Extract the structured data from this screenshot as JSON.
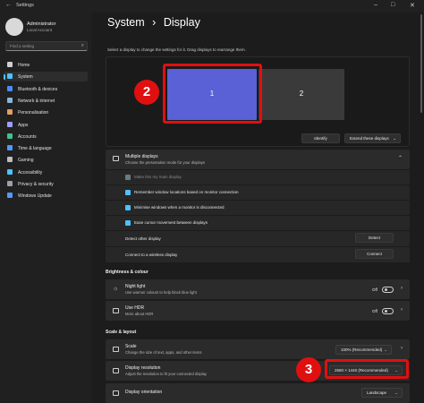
{
  "window": {
    "title": "Settings"
  },
  "user": {
    "name": "Administrator",
    "account": "Local Account"
  },
  "search": {
    "placeholder": "Find a setting"
  },
  "sidebar": {
    "items": [
      {
        "label": "Home",
        "icon": "home-icon",
        "color": "#cfcfcf"
      },
      {
        "label": "System",
        "icon": "system-icon",
        "color": "#4cc2ff"
      },
      {
        "label": "Bluetooth & devices",
        "icon": "bluetooth-icon",
        "color": "#4c8bff"
      },
      {
        "label": "Network & internet",
        "icon": "network-icon",
        "color": "#8ab4d8"
      },
      {
        "label": "Personalisation",
        "icon": "brush-icon",
        "color": "#e0a060"
      },
      {
        "label": "Apps",
        "icon": "apps-icon",
        "color": "#9aa0ff"
      },
      {
        "label": "Accounts",
        "icon": "accounts-icon",
        "color": "#3ec28f"
      },
      {
        "label": "Time & language",
        "icon": "clock-icon",
        "color": "#4c9bff"
      },
      {
        "label": "Gaming",
        "icon": "gaming-icon",
        "color": "#bdbdbd"
      },
      {
        "label": "Accessibility",
        "icon": "accessibility-icon",
        "color": "#4cc2ff"
      },
      {
        "label": "Privacy & security",
        "icon": "shield-icon",
        "color": "#9aa0a8"
      },
      {
        "label": "Windows Update",
        "icon": "update-icon",
        "color": "#4c9bff"
      }
    ]
  },
  "breadcrumb": {
    "parent": "System",
    "separator": "›",
    "current": "Display"
  },
  "arrange": {
    "hint": "Select a display to change the settings for it. Drag displays to rearrange them.",
    "monitor1": "1",
    "monitor2": "2",
    "identify": "Identify",
    "extend": "Extend these displays"
  },
  "annotations": {
    "badge_a": "2",
    "badge_b": "3"
  },
  "multiple": {
    "title": "Multiple displays",
    "subtitle": "Choose the presentation mode for your displays",
    "options": [
      "Make this my main display",
      "Remember window locations based on monitor connection",
      "Minimise windows when a monitor is disconnected",
      "Ease cursor movement between displays"
    ],
    "detect_label": "Detect other display",
    "detect_button": "Detect",
    "wireless_label": "Connect to a wireless display",
    "connect_button": "Connect"
  },
  "brightness": {
    "section": "Brightness & colour",
    "night_light": {
      "title": "Night light",
      "subtitle": "Use warmer colours to help block blue light",
      "state": "Off"
    },
    "hdr": {
      "title": "Use HDR",
      "subtitle": "More about HDR",
      "state": "Off"
    }
  },
  "scale_layout": {
    "section": "Scale & layout",
    "scale": {
      "title": "Scale",
      "subtitle": "Change the size of text, apps, and other items",
      "value": "100% (Recommended)"
    },
    "resolution": {
      "title": "Display resolution",
      "subtitle": "Adjust the resolution to fit your connected display",
      "value": "2560 × 1440 (Recommended)"
    },
    "orientation": {
      "title": "Display orientation",
      "value": "Landscape"
    }
  }
}
